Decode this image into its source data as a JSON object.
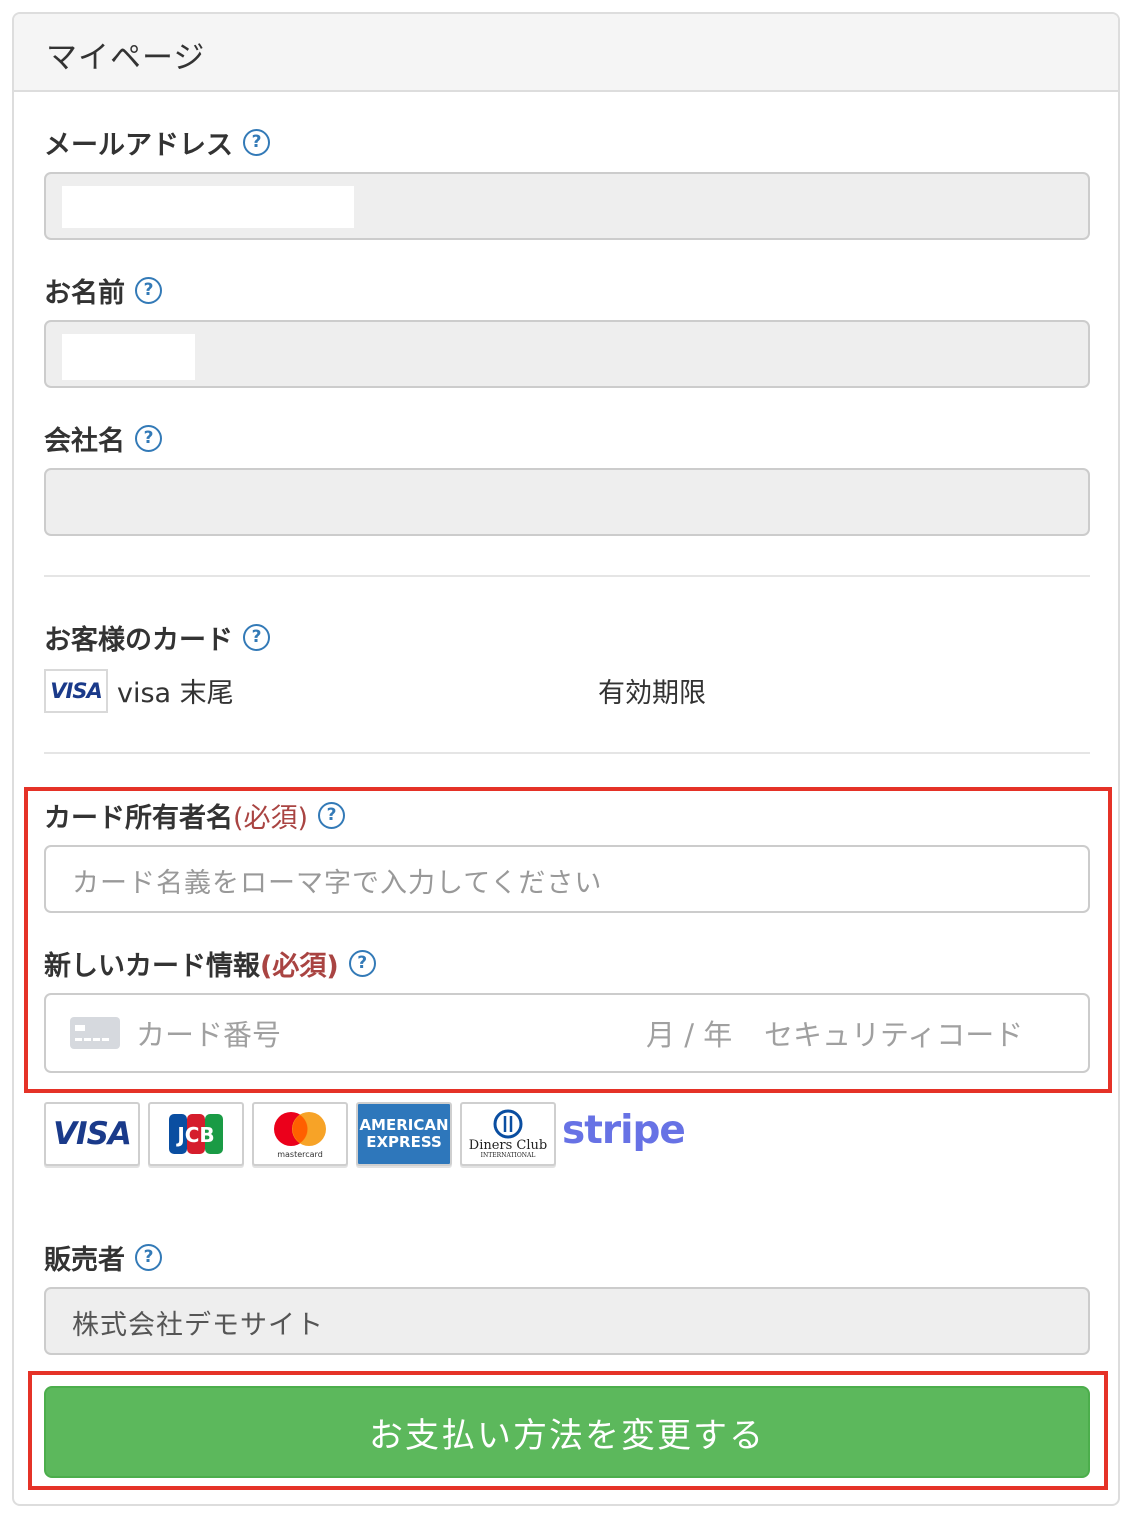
{
  "panel": {
    "title": "マイページ"
  },
  "fields": {
    "email": {
      "label": "メールアドレス",
      "help": "?"
    },
    "name": {
      "label": "お名前",
      "help": "?"
    },
    "company": {
      "label": "会社名",
      "help": "?"
    }
  },
  "saved_card": {
    "label": "お客様のカード",
    "help": "?",
    "brand_logo": "VISA",
    "brand_text": "visa 末尾",
    "expiry_label": "有効期限"
  },
  "cardholder": {
    "label": "カード所有者名",
    "required": "(必須)",
    "help": "?",
    "placeholder": "カード名義をローマ字で入力してください"
  },
  "new_card": {
    "label": "新しいカード情報",
    "required": "(必須)",
    "help": "?",
    "number_placeholder": "カード番号",
    "expiry_placeholder": "月 / 年",
    "cvc_placeholder": "セキュリティコード"
  },
  "brands": {
    "visa": "VISA",
    "jcb": "JCB",
    "mastercard": "mastercard",
    "amex_line1": "AMERICAN",
    "amex_line2": "EXPRESS",
    "diners_line1": "Diners Club",
    "diners_line2": "INTERNATIONAL",
    "stripe": "stripe"
  },
  "seller": {
    "label": "販売者",
    "help": "?",
    "value": "株式会社デモサイト"
  },
  "submit": {
    "label": "お支払い方法を変更する"
  },
  "colors": {
    "required_red": "#a94442",
    "help_blue": "#337ab7",
    "submit_green": "#5cb85c",
    "highlight_red": "#e53227",
    "stripe_purple": "#6772e5"
  }
}
